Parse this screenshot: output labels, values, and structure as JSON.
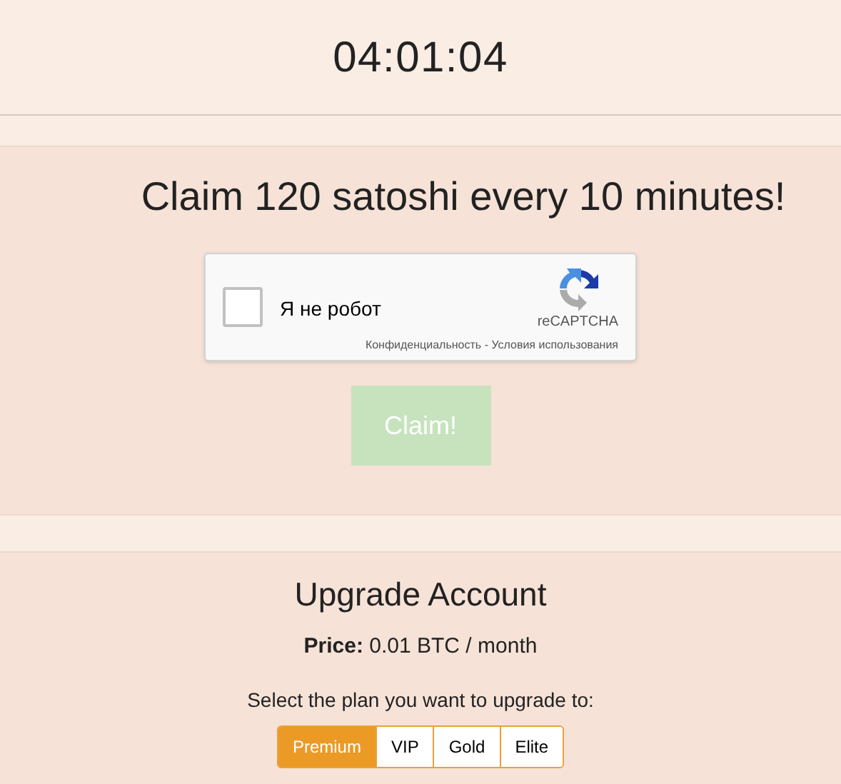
{
  "timer": "04:01:04",
  "claim": {
    "heading": "Claim 120 satoshi every 10 minutes!",
    "captcha": {
      "label": "Я не робот",
      "checked": false,
      "brand": "reCAPTCHA",
      "privacy": "Конфиденциальность",
      "separator": " - ",
      "terms": "Условия использования"
    },
    "button": {
      "label": "Claim!",
      "disabled": true
    }
  },
  "upgrade": {
    "title": "Upgrade Account",
    "price_label": "Price:",
    "price": "0.01 BTC / month",
    "prompt": "Select the plan you want to upgrade to:",
    "plans": [
      {
        "label": "Premium",
        "selected": true
      },
      {
        "label": "VIP",
        "selected": false
      },
      {
        "label": "Gold",
        "selected": false
      },
      {
        "label": "Elite",
        "selected": false
      }
    ]
  }
}
